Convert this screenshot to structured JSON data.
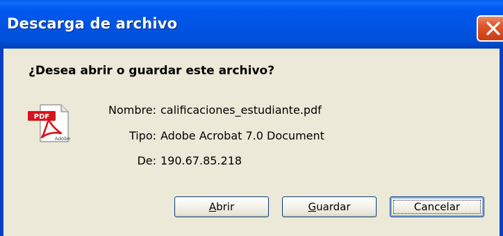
{
  "window": {
    "title": "Descarga de archivo",
    "close_icon": "close-icon"
  },
  "dialog": {
    "question": "¿Desea abrir o guardar este archivo?",
    "file_icon": "pdf-file-icon",
    "fields": [
      {
        "label": "Nombre:",
        "value": "calificaciones_estudiante.pdf"
      },
      {
        "label": "Tipo:",
        "value": "Adobe Acrobat 7.0 Document"
      },
      {
        "label": "De:",
        "value": "190.67.85.218"
      }
    ]
  },
  "buttons": {
    "open": {
      "underlined": "A",
      "rest": "brir"
    },
    "save": {
      "underlined": "G",
      "rest": "uardar"
    },
    "cancel": {
      "label": "Cancelar"
    }
  },
  "colors": {
    "titlebar": "#0054e3",
    "close_button": "#e0592f",
    "dialog_background": "#ece9d8",
    "button_border": "#003c74",
    "pdf_red": "#d7151c"
  }
}
